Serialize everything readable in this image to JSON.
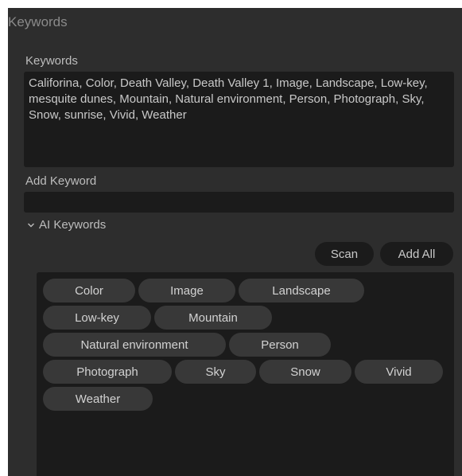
{
  "panel": {
    "title": "Keywords"
  },
  "keywords": {
    "label": "Keywords",
    "text": "Califorina, Color, Death Valley, Death Valley 1, Image, Landscape, Low-key, mesquite dunes, Mountain, Natural environment, Person, Photograph, Sky, Snow, sunrise, Vivid, Weather"
  },
  "add_keyword": {
    "label": "Add Keyword",
    "value": "",
    "placeholder": ""
  },
  "ai_keywords": {
    "header": "AI Keywords",
    "expanded": true,
    "scan_label": "Scan",
    "add_all_label": "Add All",
    "chips": [
      "Color",
      "Image",
      "Landscape",
      "Low-key",
      "Mountain",
      "Natural environment",
      "Person",
      "Photograph",
      "Sky",
      "Snow",
      "Vivid",
      "Weather"
    ]
  },
  "colors": {
    "panel_bg": "#2d2d2d",
    "field_bg": "#1b1b1b",
    "chip_bg": "#383838",
    "text": "#c9c9c9"
  }
}
